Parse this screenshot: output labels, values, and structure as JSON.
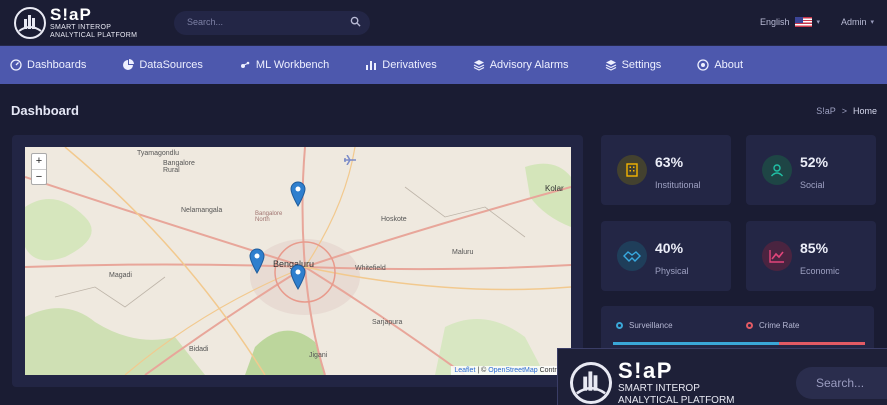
{
  "brand": {
    "title": "S!aP",
    "subtitle_1": "SMART INTEROP",
    "subtitle_2": "ANALYTICAL PLATFORM"
  },
  "search": {
    "placeholder": "Search..."
  },
  "header": {
    "language": "English",
    "user": "Admin"
  },
  "nav": {
    "items": [
      {
        "label": "Dashboards",
        "icon": "dashboard-icon"
      },
      {
        "label": "DataSources",
        "icon": "pie-chart-icon"
      },
      {
        "label": "ML Workbench",
        "icon": "ml-icon"
      },
      {
        "label": "Derivatives",
        "icon": "bar-chart-icon"
      },
      {
        "label": "Advisory Alarms",
        "icon": "layers-icon"
      },
      {
        "label": "Settings",
        "icon": "settings-layers-icon"
      },
      {
        "label": "About",
        "icon": "info-icon"
      }
    ]
  },
  "page": {
    "title": "Dashboard",
    "breadcrumb_root": "S!aP",
    "breadcrumb_sep": ">",
    "breadcrumb_current": "Home"
  },
  "map": {
    "zoom_in": "+",
    "zoom_out": "−",
    "attribution_leaflet": "Leaflet",
    "attribution_sep": " | © ",
    "attribution_osm": "OpenStreetMap",
    "attribution_contrib": " Contribut",
    "labels": {
      "tyamagondlu": "Tyamagondlu",
      "bangalore_rural": "Bangalore Rural",
      "nelamangala": "Nelamangala",
      "magadi": "Magadi",
      "bengaluru": "Bengaluru",
      "hoskote": "Hoskote",
      "kolar": "Kolar",
      "whitefield": "Whitefield",
      "maluru": "Maluru",
      "sarjapura": "Sarjapura",
      "bidadi": "Bidadi",
      "jigani": "Jigani",
      "bangalore_north": "Bangalore North"
    }
  },
  "stats": [
    {
      "value": "63%",
      "label": "Institutional",
      "icon": "building-icon",
      "color": "#f4b400"
    },
    {
      "value": "52%",
      "label": "Social",
      "icon": "user-icon",
      "color": "#21c0a5"
    },
    {
      "value": "40%",
      "label": "Physical",
      "icon": "handshake-icon",
      "color": "#38a9e0"
    },
    {
      "value": "85%",
      "label": "Economic",
      "icon": "trend-chart-icon",
      "color": "#e2457a"
    }
  ],
  "legend": {
    "items": [
      {
        "label": "Surveillance",
        "color": "#3aa7d8"
      },
      {
        "label": "Crime Rate",
        "color": "#e25a64"
      }
    ]
  },
  "overlay": {
    "title": "S!aP",
    "subtitle_1": "SMART INTEROP",
    "subtitle_2": "ANALYTICAL PLATFORM",
    "search_placeholder": "Search..."
  }
}
